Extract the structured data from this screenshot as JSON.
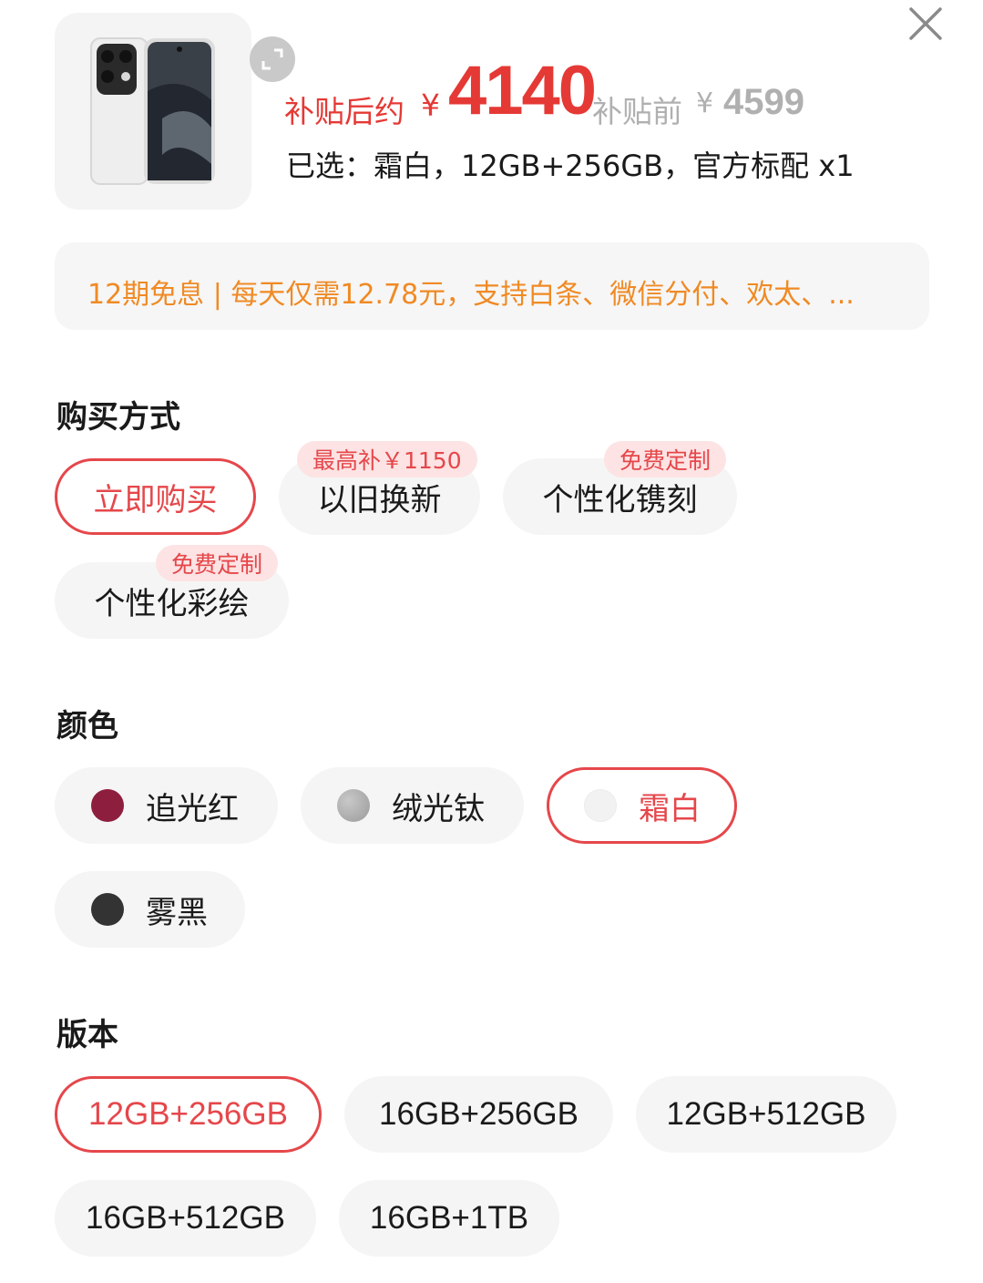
{
  "header": {
    "price_label": "补贴后约",
    "currency": "¥",
    "price": "4140",
    "original_label": "补贴前",
    "original_price": "4599",
    "selected_text": "已选：霜白，12GB+256GB，官方标配 x1",
    "product_image": "phone-image",
    "icons": {
      "close": "close-icon",
      "expand": "expand-icon"
    }
  },
  "installment": {
    "text": "12期免息 | 每天仅需12.78元，支持白条、微信分付、欢太、..."
  },
  "purchase": {
    "title": "购买方式",
    "options": [
      {
        "label": "立即购买",
        "badge": "",
        "selected": true
      },
      {
        "label": "以旧换新",
        "badge": "最高补￥1150",
        "selected": false
      },
      {
        "label": "个性化镌刻",
        "badge": "免费定制",
        "selected": false
      },
      {
        "label": "个性化彩绘",
        "badge": "免费定制",
        "selected": false
      }
    ]
  },
  "color": {
    "title": "颜色",
    "options": [
      {
        "label": "追光红",
        "swatch": "#8e1e3e",
        "selected": false
      },
      {
        "label": "绒光钛",
        "swatch": "#a8a8a8",
        "selected": false
      },
      {
        "label": "霜白",
        "swatch": "#f2f2f2",
        "selected": true
      },
      {
        "label": "雾黑",
        "swatch": "#333333",
        "selected": false
      }
    ]
  },
  "version": {
    "title": "版本",
    "options": [
      {
        "label": "12GB+256GB",
        "selected": true
      },
      {
        "label": "16GB+256GB",
        "selected": false
      },
      {
        "label": "12GB+512GB",
        "selected": false
      },
      {
        "label": "16GB+512GB",
        "selected": false
      },
      {
        "label": "16GB+1TB",
        "selected": false
      }
    ]
  },
  "colors": {
    "accent": "#e5474b",
    "installment": "#f08a24",
    "chip_bg": "#f5f5f5",
    "badge_bg": "#fde3e3"
  }
}
